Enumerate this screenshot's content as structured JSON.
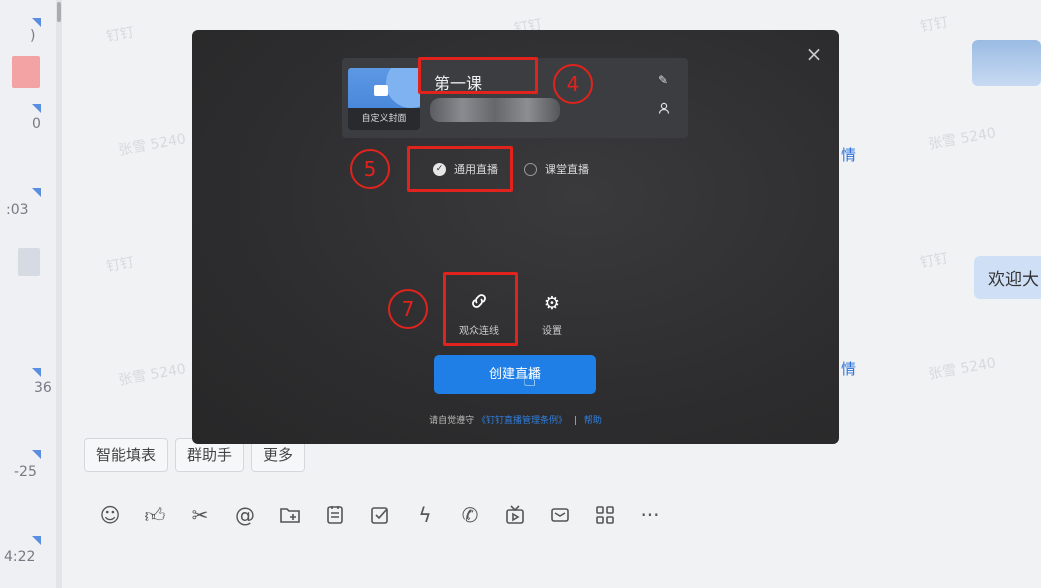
{
  "sidebar_times": [
    ")",
    "0",
    ":03",
    "36",
    "-25",
    "4:22"
  ],
  "watermarks": [
    "钉钉",
    "张雪 5240"
  ],
  "background": {
    "detail_link": "情",
    "bubble_text": "欢迎大",
    "quick_actions": [
      "智能填表",
      "群助手",
      "更多"
    ],
    "toolbar_icons": [
      "emoji-icon",
      "thumbs-up-icon",
      "scissors-icon",
      "at-icon",
      "folder-add-icon",
      "document-icon",
      "checkbox-icon",
      "lightning-icon",
      "phone-icon",
      "tv-icon",
      "mail-icon",
      "apps-icon",
      "more-icon"
    ]
  },
  "modal": {
    "close_glyph": "×",
    "cover_label": "自定义封面",
    "title": "第一课",
    "live_types": [
      {
        "label": "通用直播",
        "selected": true
      },
      {
        "label": "课堂直播",
        "selected": false
      }
    ],
    "functions": [
      {
        "label": "观众连线",
        "icon": "link-icon"
      },
      {
        "label": "设置",
        "icon": "gear-icon"
      }
    ],
    "create_button": "创建直播",
    "terms_prefix": "请自觉遵守",
    "terms_link": "《钉钉直播管理条例》",
    "terms_sep": "|",
    "help_link": "帮助"
  },
  "annotations": [
    "4",
    "5",
    "7"
  ],
  "colors": {
    "annotation_red": "#e0231c",
    "primary_blue": "#1f7fe6",
    "modal_bg": "#2d2d2f"
  }
}
